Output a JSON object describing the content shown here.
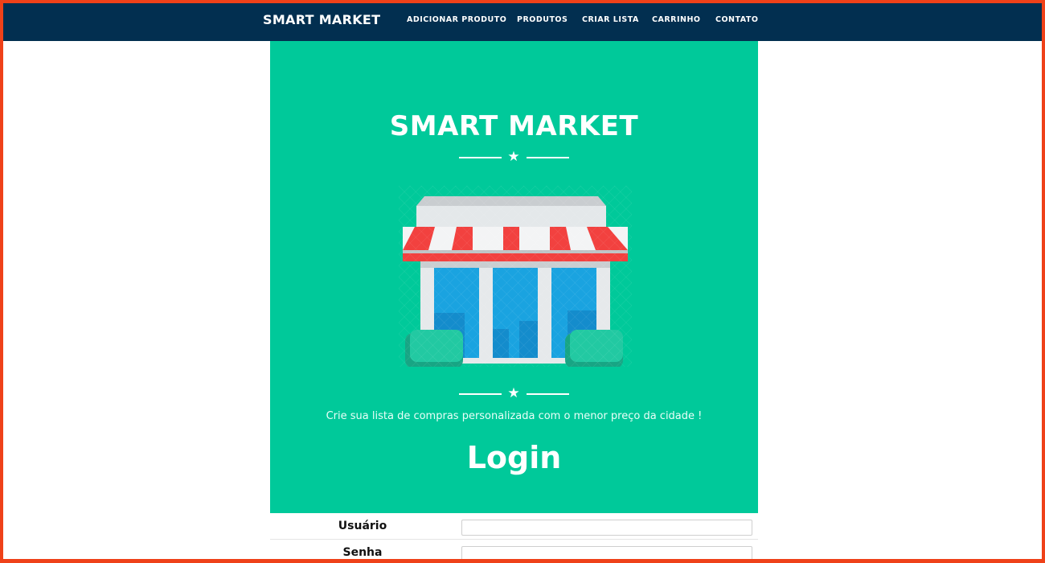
{
  "navbar": {
    "brand": "SMART MARKET",
    "items": [
      {
        "label": "ADICIONAR PRODUTO"
      },
      {
        "label": "PRODUTOS"
      },
      {
        "label": "CRIAR LISTA"
      },
      {
        "label": "CARRINHO"
      },
      {
        "label": "CONTATO"
      }
    ]
  },
  "hero": {
    "title": "SMART MARKET",
    "divider_icon": "star-icon",
    "illustration_icon": "storefront-icon",
    "tagline": "Crie sua lista de compras personalizada com o menor preço da cidade !",
    "login_heading": "Login"
  },
  "form": {
    "username_label": "Usuário",
    "username_value": "",
    "password_label": "Senha",
    "password_value": ""
  },
  "colors": {
    "navbar": "#022f50",
    "hero": "#00c99a",
    "frame_border": "#ef4119",
    "awning_red": "#f2413f",
    "glass_blue": "#1aa3e0"
  }
}
